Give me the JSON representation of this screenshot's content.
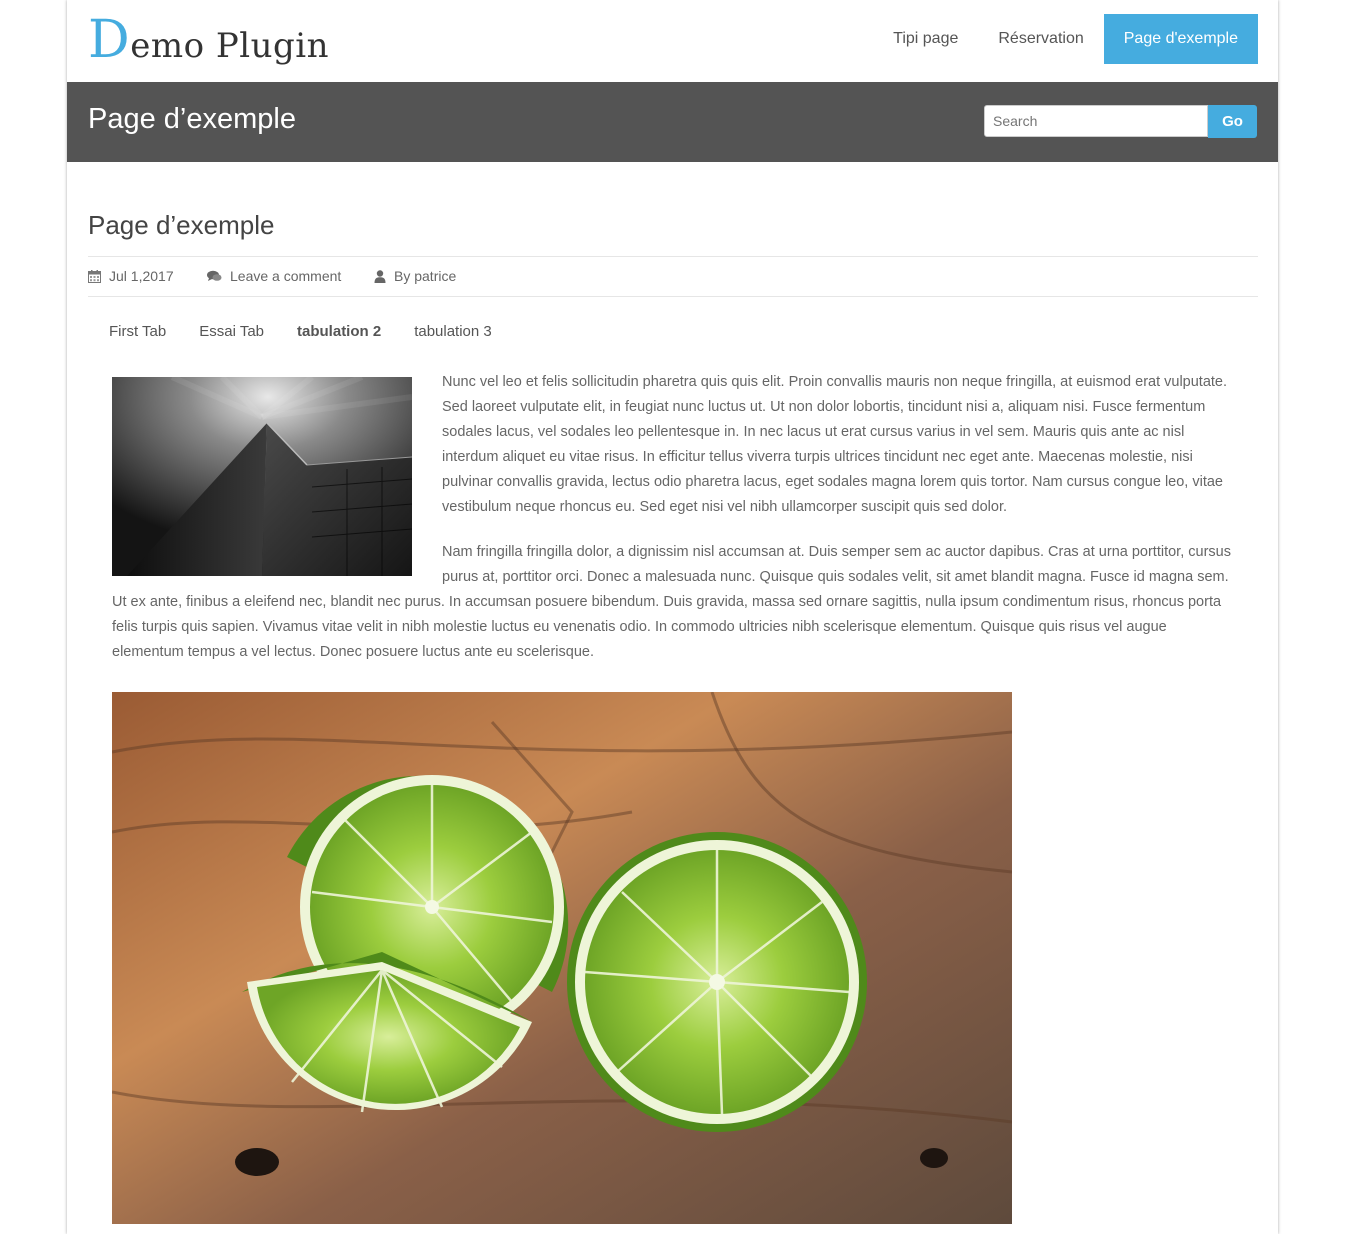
{
  "site": {
    "logo_initial": "D",
    "logo_rest": "emo Plugin",
    "nav": [
      {
        "label": "Tipi page"
      },
      {
        "label": "Réservation"
      },
      {
        "label": "Page d'exemple",
        "active": true
      }
    ]
  },
  "header": {
    "title": "Page d’exemple",
    "search_placeholder": "Search",
    "go_label": "Go"
  },
  "post": {
    "title": "Page d’exemple",
    "date": "Jul 1,2017",
    "comment_link": "Leave a comment",
    "author": "By patrice",
    "tabs": [
      {
        "label": "First Tab"
      },
      {
        "label": "Essai Tab"
      },
      {
        "label": "tabulation 2",
        "selected": true
      },
      {
        "label": "tabulation 3"
      }
    ],
    "paragraph1": "Nunc vel leo et felis sollicitudin pharetra quis quis elit. Proin convallis mauris non neque fringilla, at euismod erat vulputate. Sed laoreet vulputate elit, in feugiat nunc luctus ut. Ut non dolor lobortis, tincidunt nisi a, aliquam nisi. Fusce fermentum sodales lacus, vel sodales leo pellentesque in. In nec lacus ut erat cursus varius in vel sem. Mauris quis ante ac nisl interdum aliquet eu vitae risus. In efficitur tellus viverra turpis ultrices tincidunt nec eget ante. Maecenas molestie, nisi pulvinar convallis gravida, lectus odio pharetra lacus, eget sodales magna lorem quis tortor. Nam cursus congue leo, vitae vestibulum neque rhoncus eu. Sed eget nisi vel nibh ullamcorper suscipit quis sed dolor.",
    "paragraph2": "Nam fringilla fringilla dolor, a dignissim nisl accumsan at. Duis semper sem ac auctor dapibus. Cras at urna porttitor, cursus purus at, porttitor orci. Donec a malesuada nunc. Quisque quis sodales velit, sit amet blandit magna. Fusce id magna sem. Ut ex ante, finibus a eleifend nec, blandit nec purus. In accumsan posuere bibendum. Duis gravida, massa sed ornare sagittis, nulla ipsum condimentum risus, rhoncus porta felis turpis quis sapien. Vivamus vitae velit in nibh molestie luctus eu venenatis odio. In commodo ultricies nibh scelerisque elementum. Quisque quis risus vel augue elementum tempus a vel lectus. Donec posuere luctus ante eu scelerisque."
  },
  "colors": {
    "accent": "#45acdf",
    "band": "#545454"
  },
  "icons": [
    "calendar-icon",
    "comments-icon",
    "user-icon"
  ]
}
